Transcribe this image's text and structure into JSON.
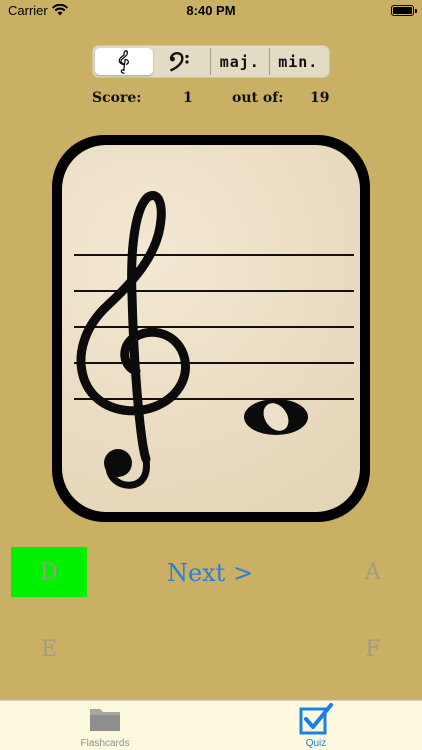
{
  "status_bar": {
    "carrier": "Carrier",
    "time": "8:40 PM"
  },
  "segments": {
    "items": [
      {
        "name": "treble-clef",
        "icon": "treble-clef-icon",
        "selected": true
      },
      {
        "name": "bass-clef",
        "icon": "bass-clef-icon",
        "selected": false
      },
      {
        "name": "major",
        "label": "maj.",
        "selected": false
      },
      {
        "name": "minor",
        "label": "min.",
        "selected": false
      }
    ]
  },
  "score": {
    "label": "Score:",
    "value": "1",
    "out_of_label": "out of:",
    "total": "19"
  },
  "card": {
    "clef": "treble",
    "note_icon": "whole-note-icon"
  },
  "answers": {
    "d": "D",
    "a": "A",
    "e": "E",
    "f": "F",
    "next": "Next >",
    "correct_color": "#00f000"
  },
  "tabs": {
    "flashcards": {
      "label": "Flashcards",
      "icon": "folder-icon"
    },
    "quiz": {
      "label": "Quiz",
      "icon": "checkbox-icon",
      "active": true
    }
  },
  "colors": {
    "background": "#c9b064",
    "accent": "#2a7fd4",
    "card_border": "#000000",
    "card_paper": "#ede0c8"
  }
}
